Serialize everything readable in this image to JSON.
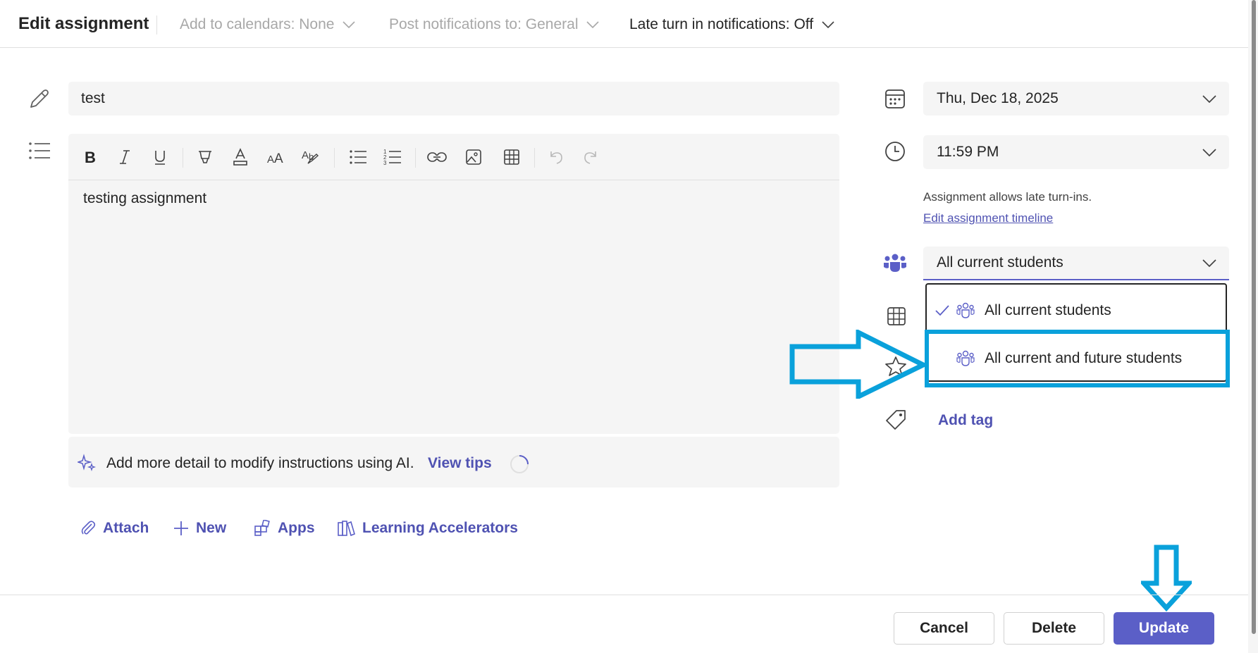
{
  "header": {
    "title": "Edit assignment",
    "add_to_calendars": "Add to calendars: None",
    "post_notifications": "Post notifications to: General",
    "late_turn_in": "Late turn in notifications: Off"
  },
  "form": {
    "title_value": "test",
    "instructions": "testing assignment",
    "ai_hint": "Add more detail to modify instructions using AI.",
    "ai_link": "View tips"
  },
  "actions": {
    "attach": "Attach",
    "new": "New",
    "apps": "Apps",
    "learning_accelerators": "Learning Accelerators"
  },
  "sidebar": {
    "due_date": "Thu, Dec 18, 2025",
    "due_time": "11:59 PM",
    "late_note": "Assignment allows late turn-ins.",
    "timeline_link": "Edit assignment timeline",
    "assign_to": "All current students",
    "options": [
      "All current students",
      "All current and future students"
    ],
    "selected_index": 0,
    "add_tag": "Add tag"
  },
  "footer": {
    "cancel": "Cancel",
    "delete": "Delete",
    "update": "Update"
  },
  "colors": {
    "accent": "#5b5fc7",
    "link": "#4f52b2",
    "annotation": "#0aa1db"
  }
}
